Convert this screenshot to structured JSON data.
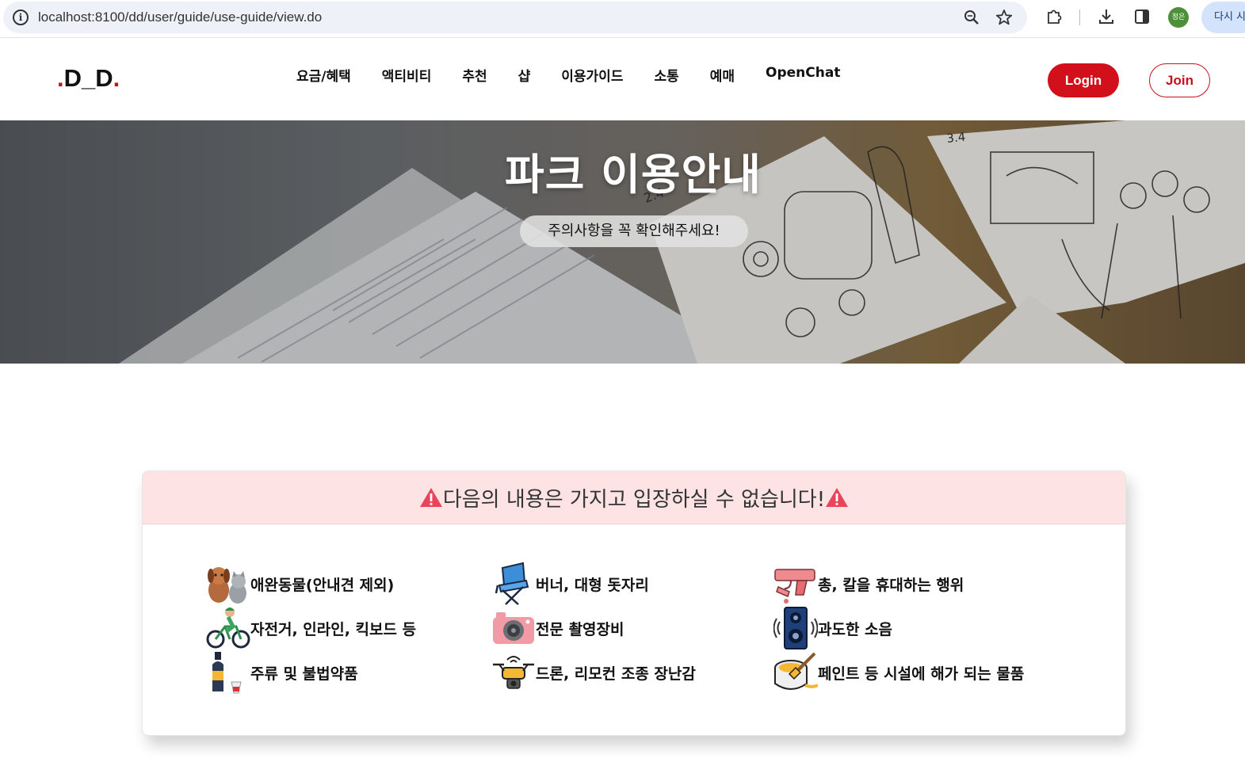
{
  "browser": {
    "url": "localhost:8100/dd/user/guide/use-guide/view.do",
    "profile_label": "정은",
    "relaunch_label": "다시 시작"
  },
  "header": {
    "logo": ".D_D.",
    "nav": [
      "요금/혜택",
      "액티비티",
      "추천",
      "샵",
      "이용가이드",
      "소통",
      "예매",
      "OpenChat"
    ],
    "login_label": "Login",
    "join_label": "Join"
  },
  "hero": {
    "title": "파크 이용안내",
    "subtitle": "주의사항을 꼭 확인해주세요!"
  },
  "notice": {
    "title": "다음의 내용은 가지고 입장하실 수 없습니다!",
    "items": [
      {
        "label": "애완동물(안내견 제외)",
        "icon": "pets-icon"
      },
      {
        "label": "버너, 대형 돗자리",
        "icon": "camping-chair-icon"
      },
      {
        "label": "총, 칼을 휴대하는 행위",
        "icon": "gun-knife-icon"
      },
      {
        "label": "자전거, 인라인, 킥보드 등",
        "icon": "bicycle-icon"
      },
      {
        "label": "전문 촬영장비",
        "icon": "camera-icon"
      },
      {
        "label": "과도한 소음",
        "icon": "speaker-icon"
      },
      {
        "label": "주류 및 불법약품",
        "icon": "alcohol-icon"
      },
      {
        "label": "드론, 리모컨 조종 장난감",
        "icon": "drone-icon"
      },
      {
        "label": "페인트 등 시설에 해가 되는 물품",
        "icon": "paint-icon"
      }
    ]
  },
  "colors": {
    "brand_red": "#d1101c",
    "notice_header_bg": "#fde3e3",
    "warning_red": "#e8455c"
  }
}
